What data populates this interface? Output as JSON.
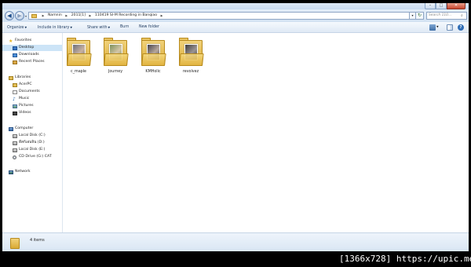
{
  "window": {
    "controls": {
      "minimize": "–",
      "maximize": "□",
      "close": "✕"
    }
  },
  "address_bar": {
    "back_glyph": "◀",
    "forward_glyph": "▶",
    "breadcrumbs": [
      "Namnin",
      "2011[1]",
      "110419 SI-M Recording in Banqiao"
    ],
    "search_placeholder": "Search 110..."
  },
  "command_bar": {
    "organize": "Organize",
    "include_in_library": "Include in library",
    "share_with": "Share with",
    "burn": "Burn",
    "new_folder": "New folder",
    "help_glyph": "?"
  },
  "nav_pane": {
    "favorites": {
      "label": "Favorites",
      "items": [
        "Desktop",
        "Downloads",
        "Recent Places"
      ]
    },
    "libraries": {
      "label": "Libraries",
      "items": [
        "AcerPC",
        "Documents",
        "Music",
        "Pictures",
        "Videos"
      ]
    },
    "computer": {
      "label": "Computer",
      "items": [
        "Local Disk (C:)",
        "ดีสก์เอนจิน (D:)",
        "Local Disk (E:)",
        "CD Drive (G:) CAT"
      ]
    },
    "network": {
      "label": "Network"
    },
    "selected": "Desktop"
  },
  "folders": [
    {
      "name": "c_maple",
      "thumb_colors": [
        "#6a6f7d",
        "#c9b2a0"
      ]
    },
    {
      "name": "Journey",
      "thumb_colors": [
        "#7b8f5a",
        "#d4c6a8"
      ]
    },
    {
      "name": "KMHolic",
      "thumb_colors": [
        "#44414c",
        "#b6a79c"
      ]
    },
    {
      "name": "revolvez",
      "thumb_colors": [
        "#3d3a3a",
        "#9a9494"
      ]
    }
  ],
  "details_bar": {
    "item_count": "4 items"
  },
  "watermark": "[1366x728] https://upic.me/"
}
